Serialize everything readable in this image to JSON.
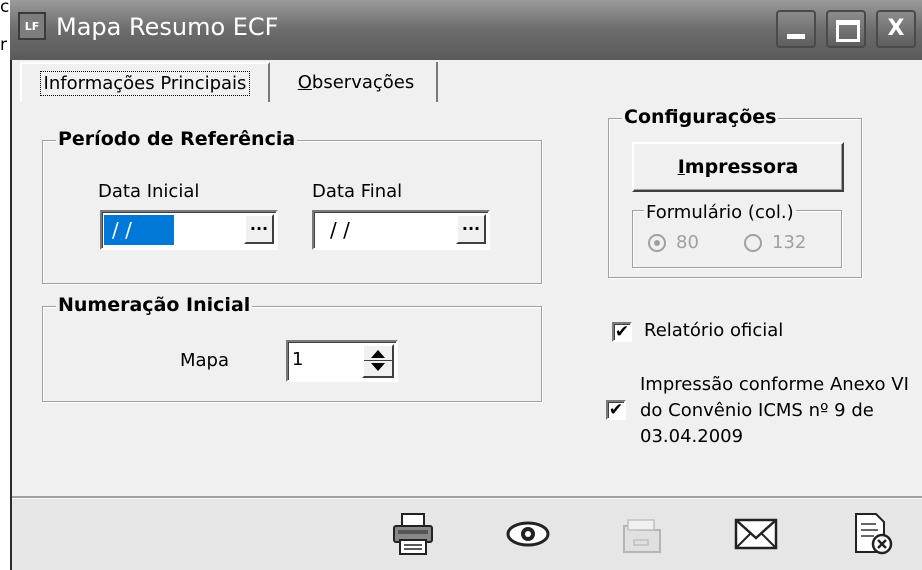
{
  "corner": {
    "top_char": "c",
    "side_char": "r"
  },
  "window": {
    "title": "Mapa Resumo ECF",
    "icon_text": "LF",
    "close_glyph": "X"
  },
  "tabs": [
    {
      "label": "Informações Principais"
    },
    {
      "label_first": "O",
      "label_rest": "bservações"
    }
  ],
  "periodo": {
    "title": "Período de Referência",
    "data_inicial_label": "Data Inicial",
    "data_inicial_value": "/ /",
    "data_final_label": "Data Final",
    "data_final_value": "/ /",
    "ellipsis": "..."
  },
  "numeracao": {
    "title": "Numeração Inicial",
    "mapa_label": "Mapa",
    "mapa_value": "1"
  },
  "config": {
    "title": "Configurações",
    "impressora_first": "I",
    "impressora_rest": "mpressora",
    "formulario_label": "Formulário (col.)",
    "options": [
      "80",
      "132"
    ],
    "selected": "80"
  },
  "checks": {
    "relatorio_label": "Relatório oficial",
    "relatorio_checked": true,
    "anexo_label": "Impressão conforme Anexo VI do Convênio ICMS nº 9 de 03.04.2009",
    "anexo_checked": true,
    "check_glyph": "✔"
  },
  "toolbar": {
    "icons": [
      "printer-icon",
      "eye-icon",
      "folder-icon",
      "mail-icon",
      "close-document-icon"
    ],
    "folder_disabled": true
  }
}
